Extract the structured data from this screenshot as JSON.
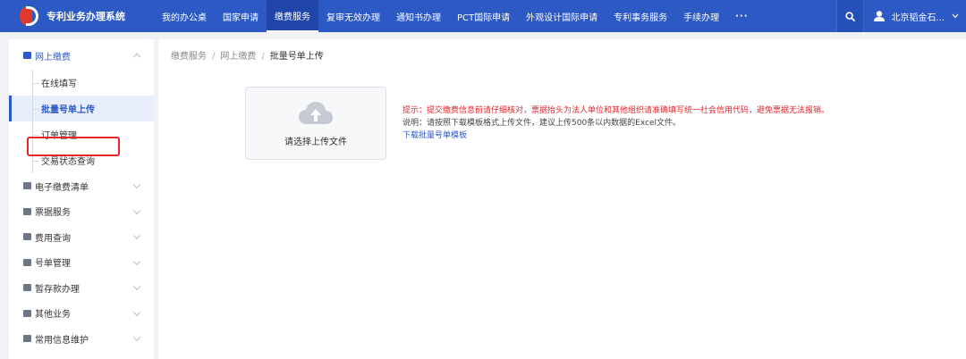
{
  "app": {
    "title": "专利业务办理系统",
    "logo": "cnipa-logo"
  },
  "nav": {
    "items": [
      {
        "label": "我的办公桌",
        "active": false
      },
      {
        "label": "国家申请",
        "active": false
      },
      {
        "label": "缴费服务",
        "active": true
      },
      {
        "label": "复审无效办理",
        "active": false
      },
      {
        "label": "通知书办理",
        "active": false
      },
      {
        "label": "PCT国际申请",
        "active": false
      },
      {
        "label": "外观设计国际申请",
        "active": false
      },
      {
        "label": "专利事务服务",
        "active": false
      },
      {
        "label": "手续办理",
        "active": false
      }
    ],
    "more_label": "···",
    "accent": "#2c59c4"
  },
  "header": {
    "search_icon": "search-icon",
    "user_name": "北京韬金石...",
    "user_icon": "user-icon"
  },
  "sidebar": {
    "open_group": {
      "label": "网上缴费",
      "icon": "payment-icon"
    },
    "sub_items": [
      {
        "label": "在线填写",
        "active": false
      },
      {
        "label": "批量号单上传",
        "active": true
      },
      {
        "label": "订单管理",
        "active": false
      },
      {
        "label": "交易状态查询",
        "active": false
      }
    ],
    "groups": [
      {
        "label": "电子缴费清单",
        "icon": "list-icon"
      },
      {
        "label": "票据服务",
        "icon": "invoice-icon"
      },
      {
        "label": "费用查询",
        "icon": "fee-query-icon"
      },
      {
        "label": "号单管理",
        "icon": "number-list-icon"
      },
      {
        "label": "暂存款办理",
        "icon": "deposit-icon"
      },
      {
        "label": "其他业务",
        "icon": "other-business-icon"
      },
      {
        "label": "常用信息维护",
        "icon": "info-maintenance-icon"
      }
    ],
    "highlight_color": "#e3262d"
  },
  "breadcrumb": [
    "缴费服务",
    "网上缴费",
    "批量号单上传"
  ],
  "breadcrumb_sep": "/",
  "upload": {
    "label": "请选择上传文件",
    "icon": "cloud-upload-icon"
  },
  "tips": {
    "warning": "提示：提交缴费信息前请仔细核对，票据抬头为法人单位和其他组织请准确填写统一社会信用代码，避免票据无法报销。",
    "note": "说明：请按照下载模板格式上传文件，建议上传500条以内数据的Excel文件。",
    "download_link": "下载批量号单模板"
  }
}
